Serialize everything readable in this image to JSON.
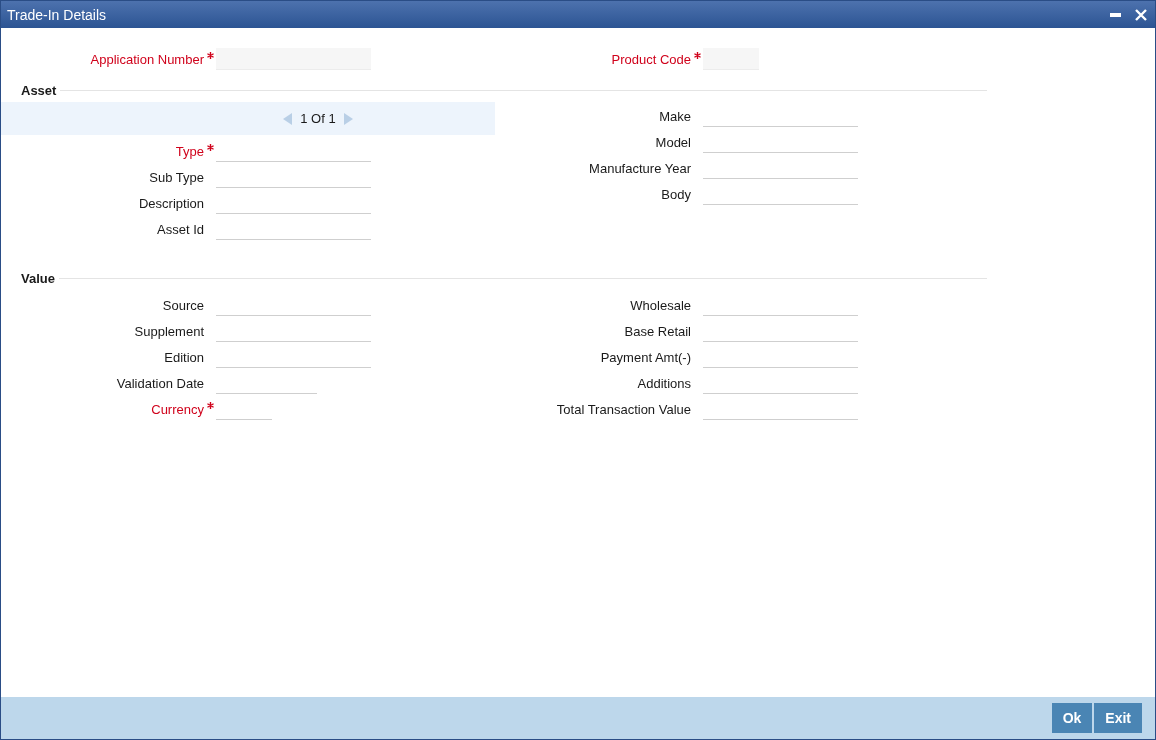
{
  "window": {
    "title": "Trade-In Details"
  },
  "header_fields": [
    {
      "label": "Application Number",
      "required": true,
      "disabled": true,
      "kind": "long"
    },
    {
      "label": "Product Code",
      "required": true,
      "disabled": true,
      "kind": "tiny"
    }
  ],
  "asset": {
    "heading": "Asset",
    "pager": "1 Of 1",
    "left_fields": [
      {
        "label": "Type",
        "required": true,
        "disabled": false,
        "kind": "long"
      },
      {
        "label": "Sub Type",
        "required": false,
        "disabled": false,
        "kind": "long"
      },
      {
        "label": "Description",
        "required": false,
        "disabled": false,
        "kind": "long"
      },
      {
        "label": "Asset Id",
        "required": false,
        "disabled": false,
        "kind": "long"
      }
    ],
    "right_fields": [
      {
        "label": "Make",
        "required": false,
        "disabled": false,
        "kind": "long"
      },
      {
        "label": "Model",
        "required": false,
        "disabled": false,
        "kind": "long"
      },
      {
        "label": "Manufacture Year",
        "required": false,
        "disabled": false,
        "kind": "long"
      },
      {
        "label": "Body",
        "required": false,
        "disabled": false,
        "kind": "long"
      }
    ]
  },
  "value": {
    "heading": "Value",
    "left_fields": [
      {
        "label": "Source",
        "required": false,
        "disabled": false,
        "kind": "long"
      },
      {
        "label": "Supplement",
        "required": false,
        "disabled": false,
        "kind": "long"
      },
      {
        "label": "Edition",
        "required": false,
        "disabled": false,
        "kind": "long"
      },
      {
        "label": "Validation Date",
        "required": false,
        "disabled": false,
        "kind": "short"
      },
      {
        "label": "Currency",
        "required": true,
        "disabled": false,
        "kind": "tiny"
      }
    ],
    "right_fields": [
      {
        "label": "Wholesale",
        "required": false,
        "disabled": false,
        "kind": "long"
      },
      {
        "label": "Base Retail",
        "required": false,
        "disabled": false,
        "kind": "long"
      },
      {
        "label": "Payment Amt(-)",
        "required": false,
        "disabled": false,
        "kind": "long"
      },
      {
        "label": "Additions",
        "required": false,
        "disabled": false,
        "kind": "long"
      },
      {
        "label": "Total Transaction Value",
        "required": false,
        "disabled": false,
        "kind": "long"
      }
    ]
  },
  "buttons": [
    "Ok",
    "Exit"
  ]
}
